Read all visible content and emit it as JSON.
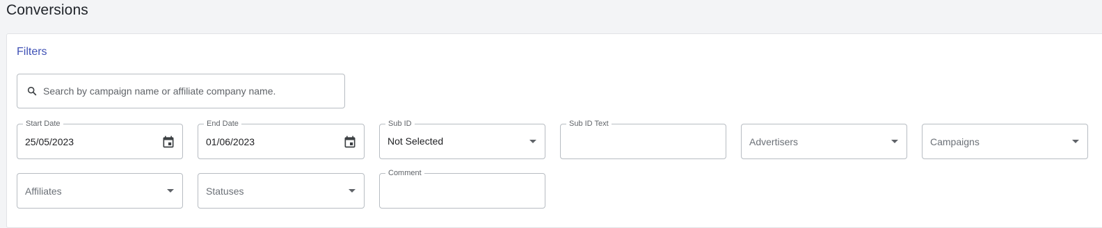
{
  "page": {
    "title": "Conversions"
  },
  "filters": {
    "title": "Filters",
    "search": {
      "placeholder": "Search by campaign name or affiliate company name.",
      "value": ""
    },
    "start_date": {
      "label": "Start Date",
      "value": "25/05/2023"
    },
    "end_date": {
      "label": "End Date",
      "value": "01/06/2023"
    },
    "sub_id": {
      "label": "Sub ID",
      "value": "Not Selected"
    },
    "sub_id_text": {
      "label": "Sub ID Text",
      "value": ""
    },
    "advertisers": {
      "placeholder": "Advertisers"
    },
    "campaigns": {
      "placeholder": "Campaigns"
    },
    "affiliates": {
      "placeholder": "Affiliates"
    },
    "statuses": {
      "placeholder": "Statuses"
    },
    "comment": {
      "label": "Comment",
      "value": ""
    }
  },
  "icons": {
    "search": "search-icon",
    "calendar": "calendar-icon",
    "dropdown": "dropdown-arrow-icon"
  },
  "colors": {
    "accent": "#3f51b5",
    "border": "#b7bcc2",
    "page_bg": "#f3f4f6"
  }
}
